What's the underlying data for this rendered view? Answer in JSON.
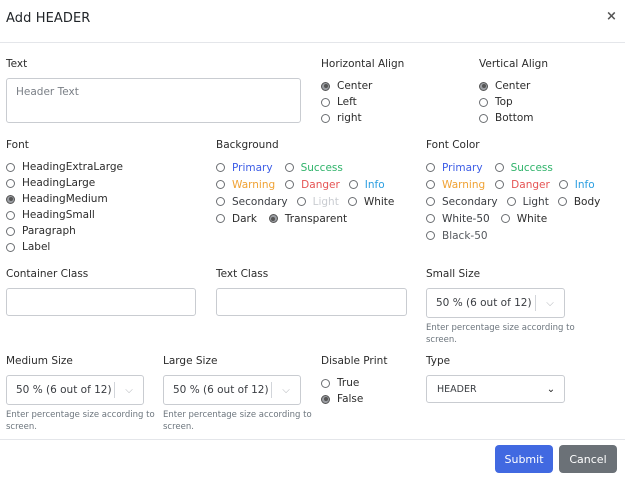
{
  "modal": {
    "title": "Add HEADER",
    "close_label": "×"
  },
  "text_field": {
    "label": "Text",
    "placeholder": "Header Text"
  },
  "horizontal_align": {
    "label": "Horizontal Align",
    "options": [
      "Center",
      "Left",
      "right"
    ],
    "selected": "Center"
  },
  "vertical_align": {
    "label": "Vertical Align",
    "options": [
      "Center",
      "Top",
      "Bottom"
    ],
    "selected": "Center"
  },
  "font": {
    "label": "Font",
    "options": [
      "HeadingExtraLarge",
      "HeadingLarge",
      "HeadingMedium",
      "HeadingSmall",
      "Paragraph",
      "Label"
    ],
    "selected": "HeadingMedium"
  },
  "background": {
    "label": "Background",
    "options": [
      "Primary",
      "Success",
      "Warning",
      "Danger",
      "Info",
      "Secondary",
      "Light",
      "White",
      "Dark",
      "Transparent"
    ],
    "selected": "Transparent"
  },
  "font_color": {
    "label": "Font Color",
    "options": [
      "Primary",
      "Success",
      "Warning",
      "Danger",
      "Info",
      "Secondary",
      "Light",
      "Body",
      "White-50",
      "White",
      "Black-50"
    ]
  },
  "container_class": {
    "label": "Container Class",
    "value": ""
  },
  "text_class": {
    "label": "Text Class",
    "value": ""
  },
  "small_size": {
    "label": "Small Size",
    "value": "50 % (6 out of 12)",
    "help": "Enter percentage size according to screen."
  },
  "medium_size": {
    "label": "Medium Size",
    "value": "50 % (6 out of 12)",
    "help": "Enter percentage size according to screen."
  },
  "large_size": {
    "label": "Large Size",
    "value": "50 % (6 out of 12)",
    "help": "Enter percentage size according to screen."
  },
  "disable_print": {
    "label": "Disable Print",
    "options": [
      "True",
      "False"
    ],
    "selected": "False"
  },
  "type": {
    "label": "Type",
    "value": "HEADER"
  },
  "footer": {
    "submit_label": "Submit",
    "cancel_label": "Cancel"
  },
  "colors": {
    "primary": "#4169e1",
    "secondary": "#6b7177",
    "success": "#2fb36a",
    "warning": "#f0a234",
    "danger": "#e55353",
    "info": "#2a9ee0"
  }
}
